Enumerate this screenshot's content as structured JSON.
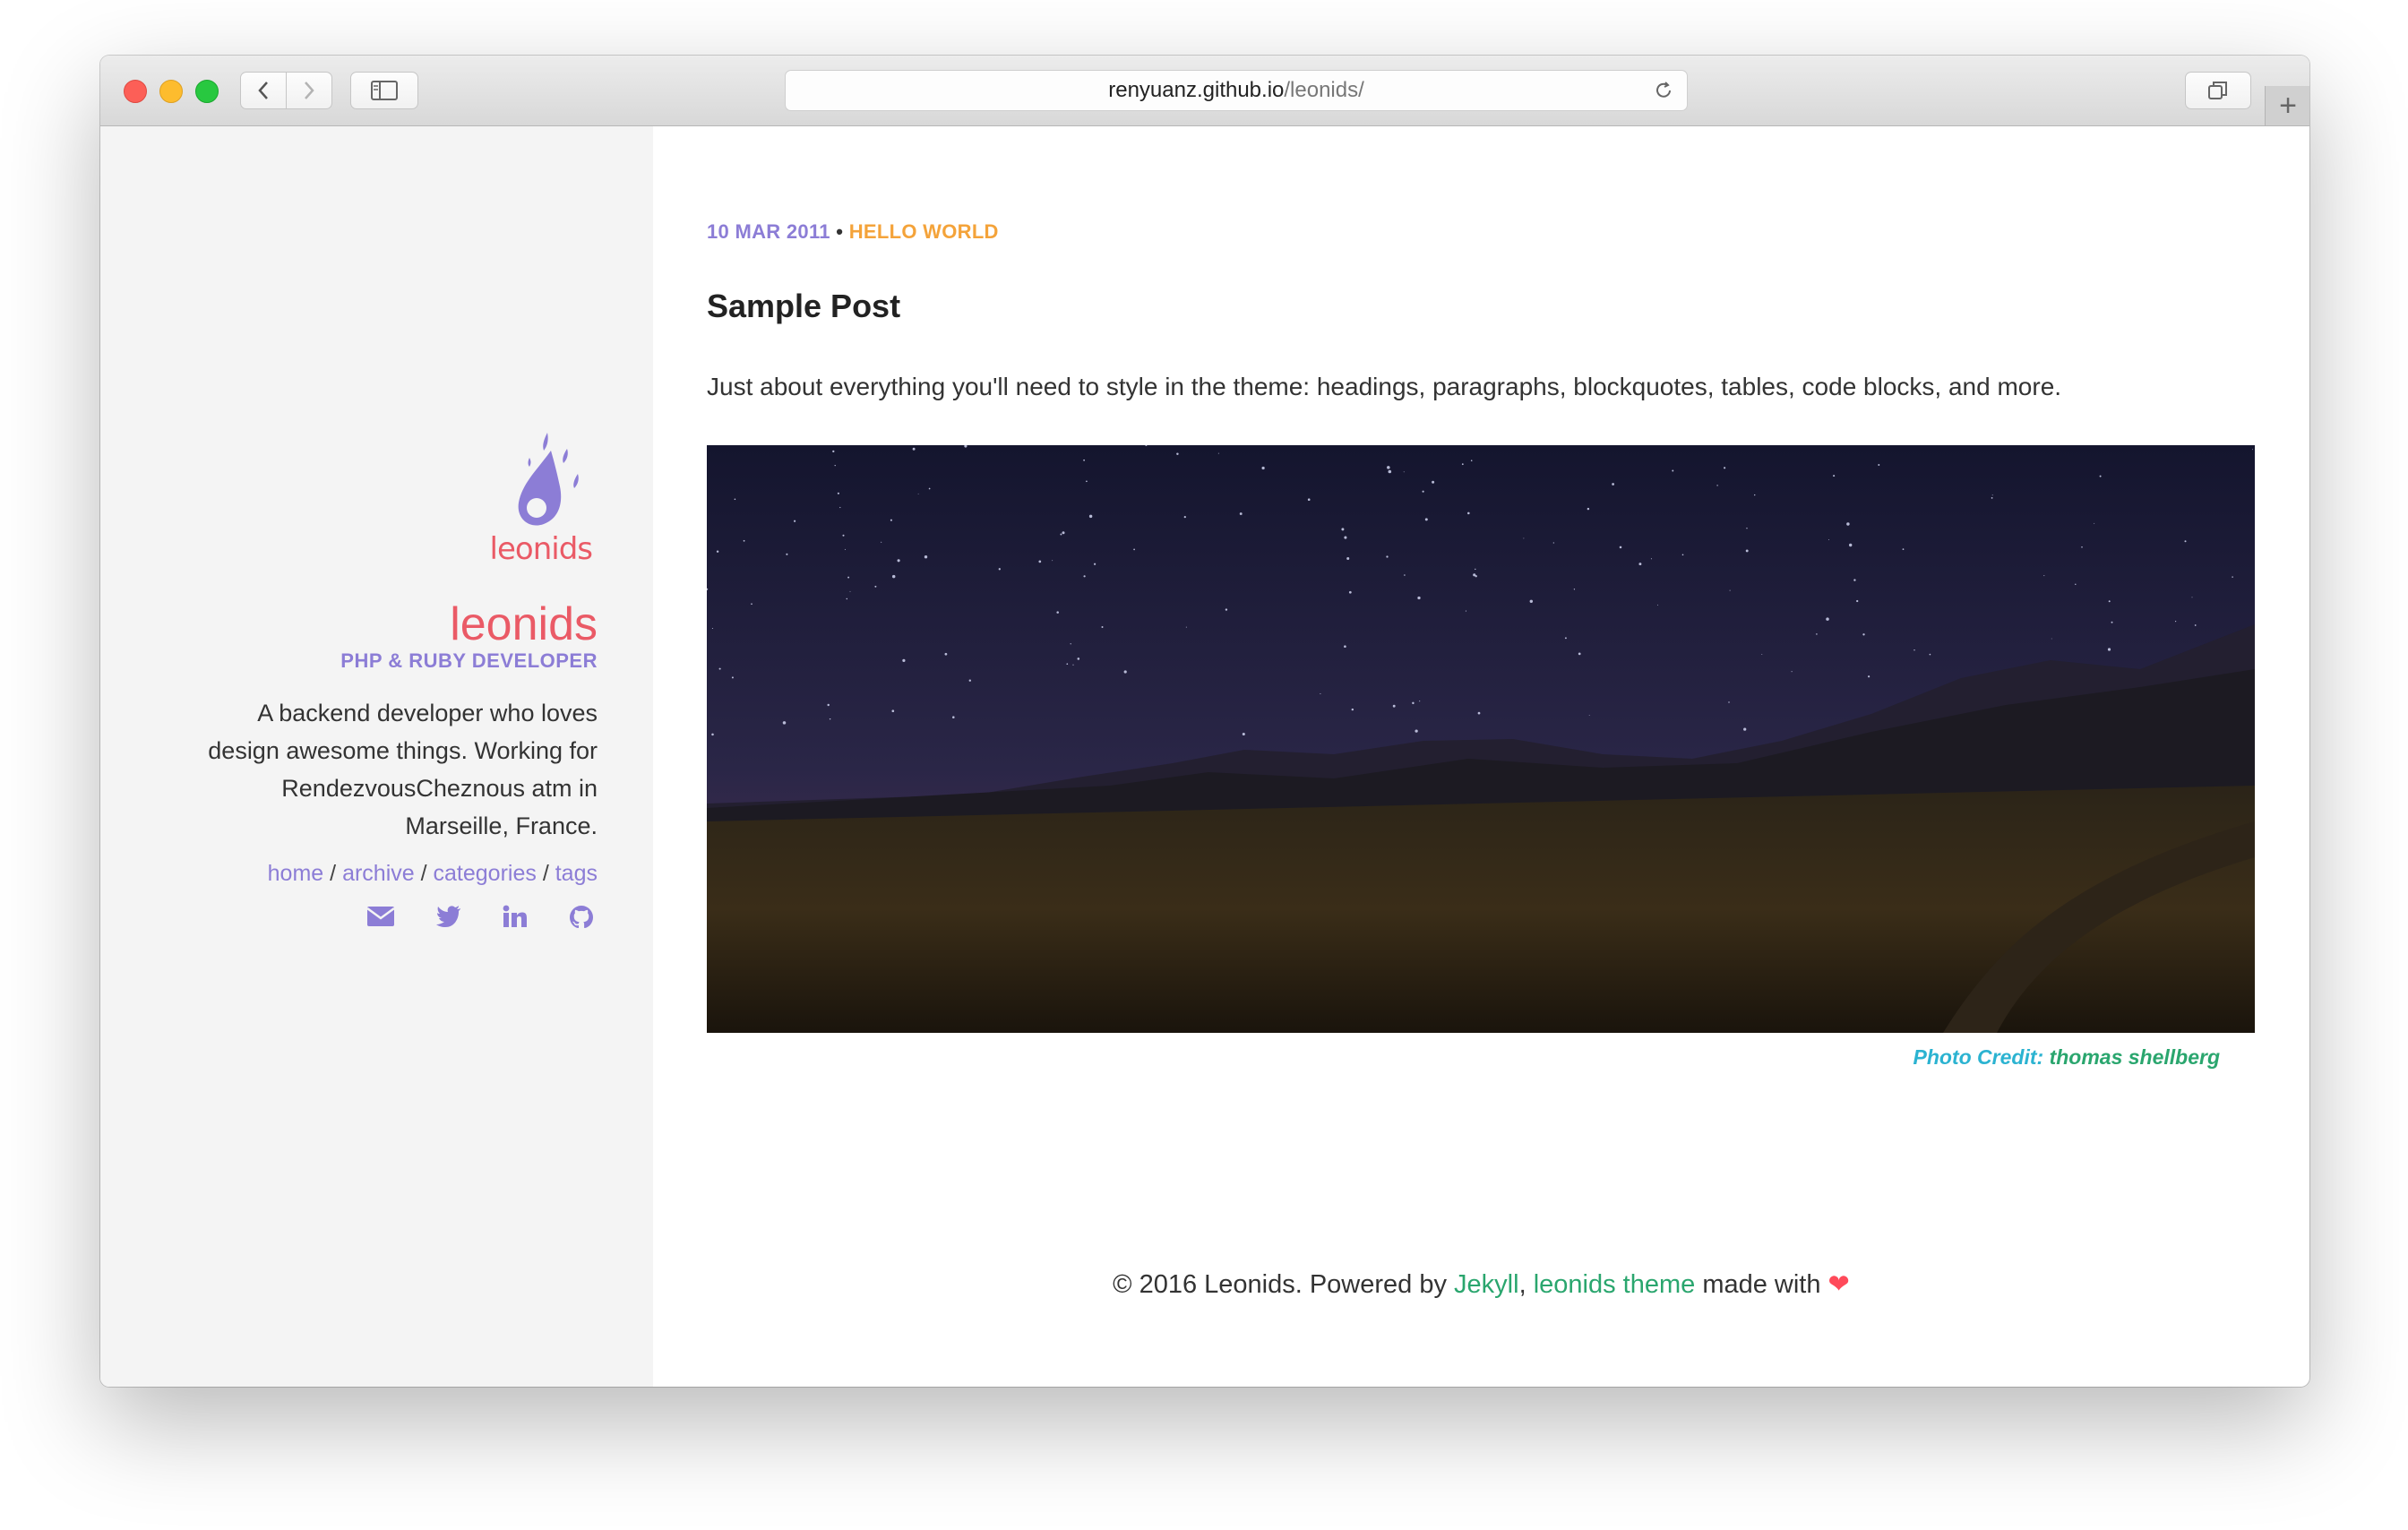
{
  "browser": {
    "url_host": "renyuanz.github.io",
    "url_path": "/leonids/"
  },
  "sidebar": {
    "logo_word": "leonids",
    "title": "leonids",
    "subtitle": "PHP & RUBY DEVELOPER",
    "description": "A backend developer who loves design awesome things. Working for RendezvousCheznous atm in Marseille, France.",
    "nav": {
      "home": "home",
      "archive": "archive",
      "categories": "categories",
      "tags": "tags",
      "separator": "/"
    },
    "social_icons": [
      "envelope-icon",
      "twitter-icon",
      "linkedin-icon",
      "github-icon"
    ]
  },
  "post": {
    "date": "10 MAR 2011",
    "bullet": "•",
    "category": "HELLO WORLD",
    "title": "Sample Post",
    "excerpt": "Just about everything you'll need to style in the theme: headings, paragraphs, blockquotes, tables, code blocks, and more.",
    "credit_label": "Photo Credit:",
    "credit_name": "thomas shellberg"
  },
  "footer": {
    "prefix": "© 2016 Leonids. Powered by",
    "jekyll": "Jekyll",
    "comma": ",",
    "theme": "leonids theme",
    "suffix": "made with",
    "heart": "❤"
  },
  "colors": {
    "accent_purple": "#8c7dd6",
    "accent_red": "#ea5a66",
    "accent_orange": "#f4a33a",
    "accent_green": "#2aa66e"
  }
}
